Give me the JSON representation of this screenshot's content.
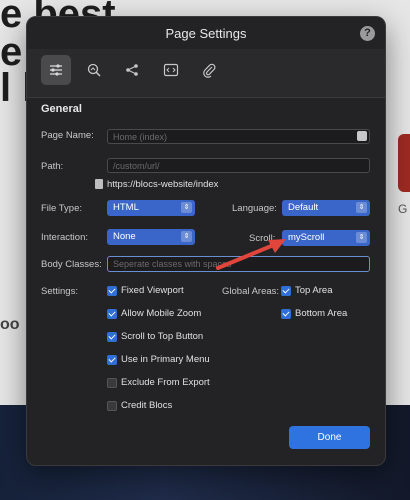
{
  "background": {
    "line1": "e best",
    "line2": "e",
    "line3": "l lo",
    "fragment1": "G",
    "fragment2": "oo"
  },
  "dialog": {
    "title": "Page Settings",
    "help_label": "?",
    "toolbar": [
      {
        "icon": "sliders-icon",
        "active": true
      },
      {
        "icon": "seo-search-icon",
        "active": false
      },
      {
        "icon": "share-icon",
        "active": false
      },
      {
        "icon": "code-icon",
        "active": false
      },
      {
        "icon": "paperclip-icon",
        "active": false
      }
    ],
    "section_title": "General",
    "page_name": {
      "label": "Page Name:",
      "placeholder": "Home (index)"
    },
    "path": {
      "label": "Path:",
      "placeholder": "/custom/url/",
      "url": "https://blocs-website/index"
    },
    "file_type": {
      "label": "File Type:",
      "value": "HTML"
    },
    "language": {
      "label": "Language:",
      "value": "Default"
    },
    "interaction": {
      "label": "Interaction:",
      "value": "None"
    },
    "scroll": {
      "label": "Scroll:",
      "value": "myScroll"
    },
    "body_classes": {
      "label": "Body Classes:",
      "placeholder": "Seperate classes with spaces"
    },
    "settings_label": "Settings:",
    "settings": [
      {
        "label": "Fixed Viewport",
        "checked": true
      },
      {
        "label": "Allow Mobile Zoom",
        "checked": true
      },
      {
        "label": "Scroll to Top Button",
        "checked": true
      },
      {
        "label": "Use in Primary Menu",
        "checked": true
      },
      {
        "label": "Exclude From Export",
        "checked": false
      },
      {
        "label": "Credit Blocs",
        "checked": false
      }
    ],
    "global_areas_label": "Global Areas:",
    "global_areas": [
      {
        "label": "Top Area",
        "checked": true
      },
      {
        "label": "Bottom Area",
        "checked": true
      }
    ],
    "done_label": "Done"
  },
  "colors": {
    "dialog_bg": "#232325",
    "accent": "#2e73e0",
    "arrow": "#e2453b"
  }
}
